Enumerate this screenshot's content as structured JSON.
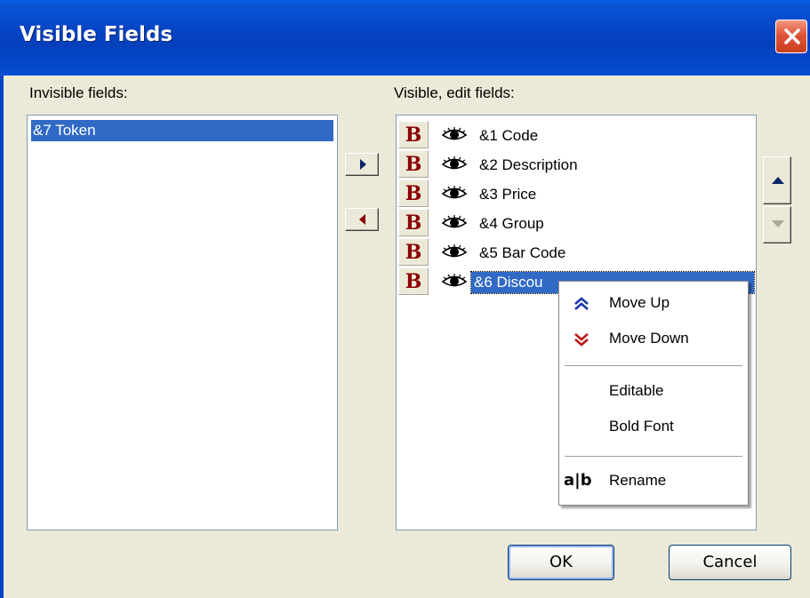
{
  "window": {
    "title": "Visible Fields"
  },
  "labels": {
    "invisible": "Invisible fields:",
    "visible": "Visible, edit fields:"
  },
  "invisible_fields": [
    {
      "label": "&7 Token",
      "selected": true
    }
  ],
  "visible_fields": [
    {
      "bold_label": "B",
      "label": "&1 Code"
    },
    {
      "bold_label": "B",
      "label": "&2 Description"
    },
    {
      "bold_label": "B",
      "label": "&3 Price"
    },
    {
      "bold_label": "B",
      "label": "&4 Group"
    },
    {
      "bold_label": "B",
      "label": "&5 Bar Code"
    },
    {
      "bold_label": "B",
      "label": "&6 Discou",
      "selected": true
    }
  ],
  "icons": {
    "close": "close-icon",
    "eye": "eye-icon",
    "move_right": "arrow-right-icon",
    "move_left": "arrow-left-icon",
    "up": "arrow-up-icon",
    "down": "arrow-down-icon"
  },
  "context_menu": {
    "move_up": "Move Up",
    "move_down": "Move Down",
    "editable": "Editable",
    "bold_font": "Bold Font",
    "rename_icon_text": "a|b",
    "rename": "Rename"
  },
  "buttons": {
    "ok": "OK",
    "cancel": "Cancel"
  },
  "colors": {
    "title_bar": "#0544c4",
    "selection": "#316ac5",
    "bold_marker": "#8b0000",
    "close_button": "#e0543a"
  }
}
